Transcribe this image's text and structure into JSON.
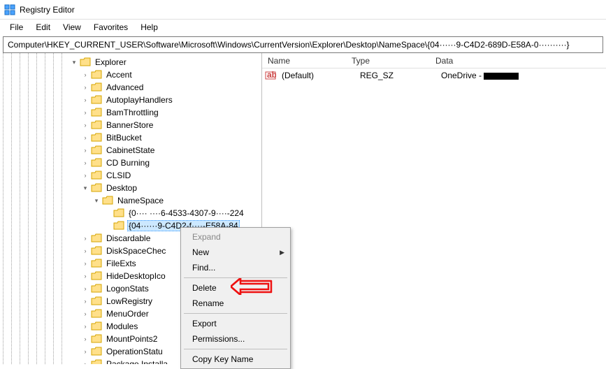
{
  "window": {
    "title": "Registry Editor"
  },
  "menubar": {
    "file": "File",
    "edit": "Edit",
    "view": "View",
    "favorites": "Favorites",
    "help": "Help"
  },
  "addressbar": {
    "path": "Computer\\HKEY_CURRENT_USER\\Software\\Microsoft\\Windows\\CurrentVersion\\Explorer\\Desktop\\NameSpace\\{04······9-C4D2-689D-E58A-0··········}"
  },
  "tree": {
    "explorer": "Explorer",
    "children": [
      "Accent",
      "Advanced",
      "AutoplayHandlers",
      "BamThrottling",
      "BannerStore",
      "BitBucket",
      "CabinetState",
      "CD Burning",
      "CLSID"
    ],
    "desktop": "Desktop",
    "namespace": "NameSpace",
    "ns_children": [
      "{0···· ····6-4533-4307-9····-224",
      "{04······9-C4D2-f····-E58A-84"
    ],
    "after": [
      "Discardable",
      "DiskSpaceChec",
      "FileExts",
      "HideDesktopIco",
      "LogonStats",
      "LowRegistry",
      "MenuOrder",
      "Modules",
      "MountPoints2",
      "OperationStatu",
      "Package Installa"
    ]
  },
  "list": {
    "headers": {
      "name": "Name",
      "type": "Type",
      "data": "Data"
    },
    "row": {
      "name": "(Default)",
      "type": "REG_SZ",
      "data_prefix": "OneDrive - "
    }
  },
  "context_menu": {
    "expand": "Expand",
    "new": "New",
    "find": "Find...",
    "delete": "Delete",
    "rename": "Rename",
    "export": "Export",
    "permissions": "Permissions...",
    "copy_key": "Copy Key Name"
  }
}
